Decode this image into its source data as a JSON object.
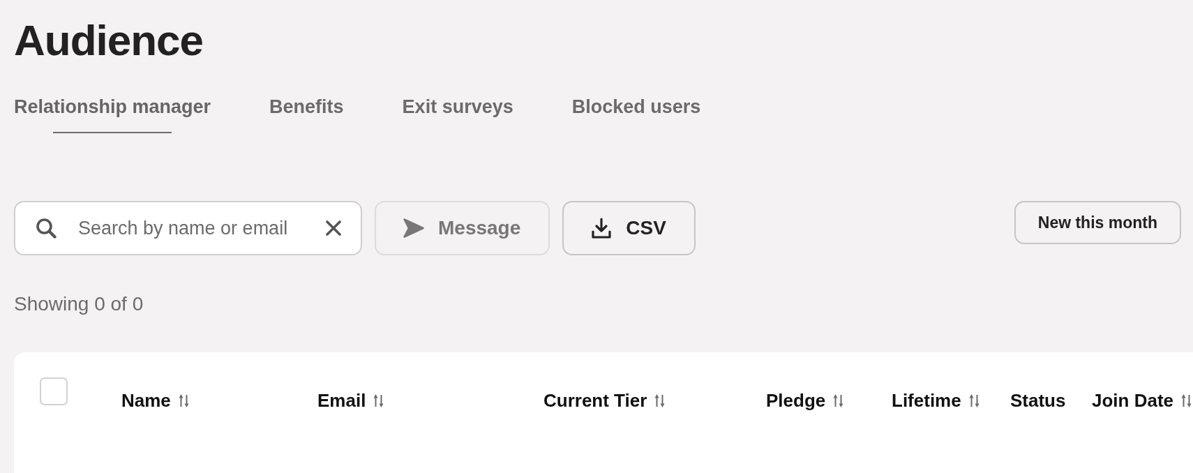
{
  "page": {
    "title": "Audience"
  },
  "tabs": [
    {
      "label": "Relationship manager",
      "selected": true
    },
    {
      "label": "Benefits",
      "selected": false
    },
    {
      "label": "Exit surveys",
      "selected": false
    },
    {
      "label": "Blocked users",
      "selected": false
    }
  ],
  "toolbar": {
    "search": {
      "placeholder": "Search by name or email"
    },
    "actions": [
      {
        "kind": "send",
        "label": "Message",
        "disabled": true
      },
      {
        "kind": "download",
        "label": "CSV",
        "disabled": false
      }
    ],
    "filters": [
      {
        "label": "New this month",
        "selected": false
      }
    ]
  },
  "results_summary": "Showing 0 of 0",
  "table": {
    "select_all": {
      "checked": false
    },
    "columns": [
      {
        "label": "Name",
        "sortable": true
      },
      {
        "label": "Email",
        "sortable": true
      },
      {
        "label": "Current Tier",
        "sortable": true
      },
      {
        "label": "Pledge",
        "sortable": true
      },
      {
        "label": "Lifetime",
        "sortable": true
      },
      {
        "label": "Status",
        "sortable": false
      },
      {
        "label": "Join Date",
        "sortable": true
      }
    ]
  }
}
